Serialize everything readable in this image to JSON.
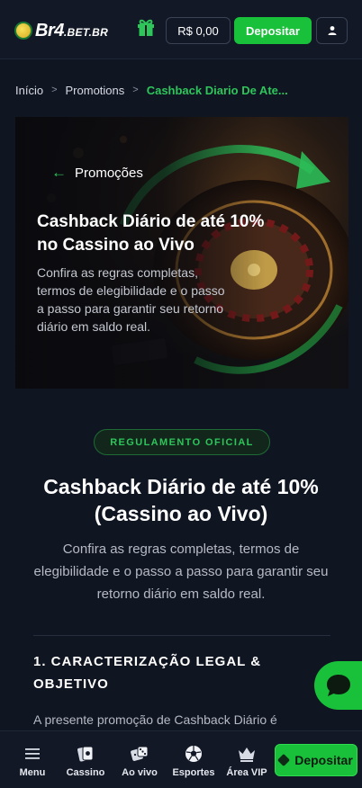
{
  "header": {
    "logo_main": "Br4",
    "logo_suffix": ".BET.BR",
    "balance": "R$ 0,00",
    "deposit_label": "Depositar"
  },
  "breadcrumb": {
    "home": "Início",
    "promotions": "Promotions",
    "current": "Cashback Diario De Ate..."
  },
  "hero": {
    "back_label": "Promoções",
    "title": "Cashback Diário de até 10% no Cassino ao Vivo",
    "description": "Confira as regras completas, termos de elegibilidade e o passo a passo para garantir seu retorno diário em saldo real."
  },
  "content": {
    "badge": "REGULAMENTO OFICIAL",
    "title": "Cashback Diário de até 10% (Cassino ao Vivo)",
    "description": "Confira as regras completas, termos de elegibilidade e o passo a passo para garantir seu retorno diário em saldo real.",
    "section_title": "1. CARACTERIZAÇÃO LEGAL & OBJETIVO",
    "section_text": "A presente promoção de Cashback Diário é"
  },
  "bottom_nav": {
    "items": [
      {
        "label": "Menu",
        "icon": "menu-icon"
      },
      {
        "label": "Cassino",
        "icon": "cards-icon"
      },
      {
        "label": "Ao vivo",
        "icon": "dice-icon"
      },
      {
        "label": "Esportes",
        "icon": "soccer-ball-icon"
      },
      {
        "label": "Área VIP",
        "icon": "crown-icon"
      }
    ],
    "deposit_label": "Depositar"
  },
  "colors": {
    "accent": "#19c13a",
    "background": "#101522",
    "header": "#121826"
  }
}
